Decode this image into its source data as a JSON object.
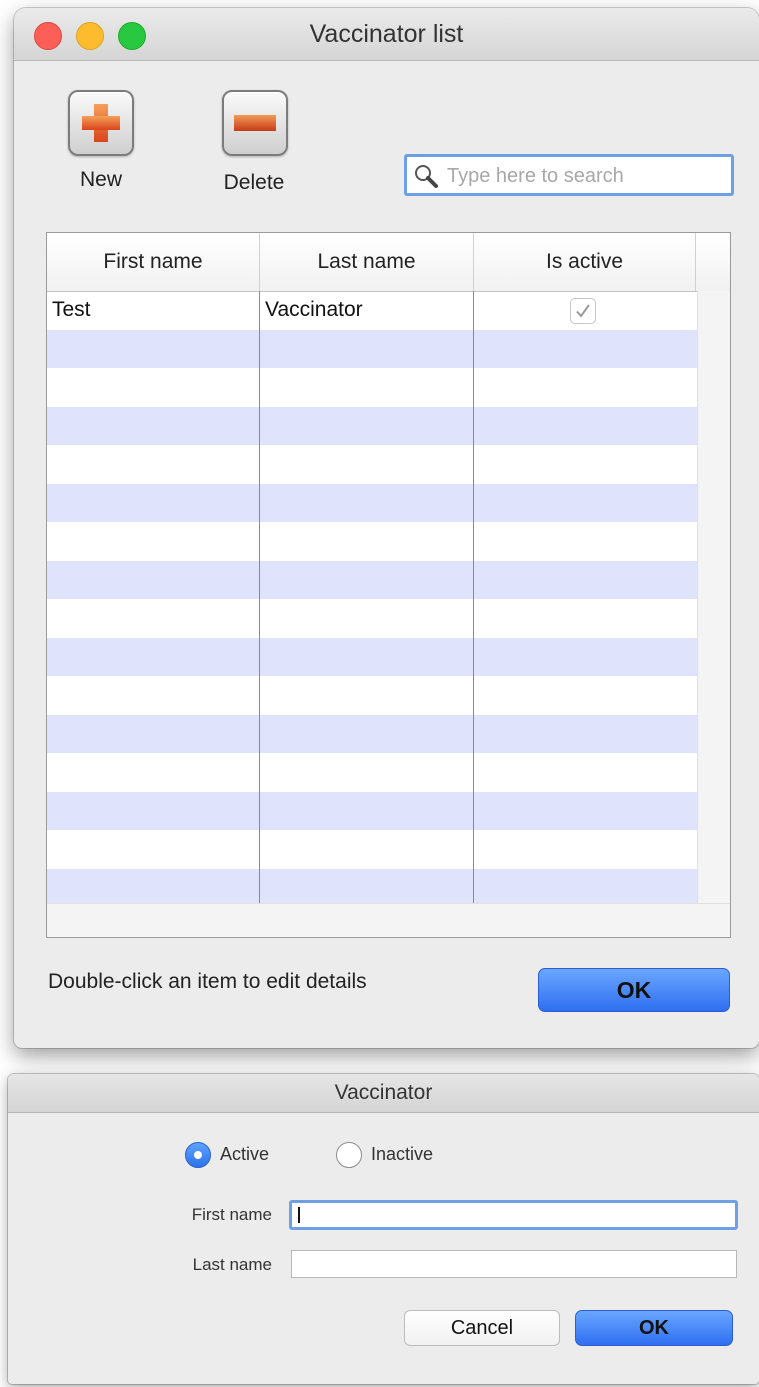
{
  "vaccinator_list_window": {
    "title": "Vaccinator list",
    "toolbar": {
      "new_label": "New",
      "delete_label": "Delete",
      "search_placeholder": "Type here to search"
    },
    "table": {
      "columns": [
        "First name",
        "Last name",
        "Is active"
      ],
      "rows": [
        {
          "first_name": "Test",
          "last_name": "Vaccinator",
          "is_active": true
        }
      ]
    },
    "hint": "Double-click an item to edit details",
    "ok_label": "OK",
    "colors": {
      "row_alt": "#dfe3fb",
      "accent": "#2f6ff0"
    }
  },
  "vaccinator_window": {
    "title": "Vaccinator",
    "status_options": {
      "active_label": "Active",
      "inactive_label": "Inactive",
      "selected": "Active"
    },
    "first_name_label": "First name",
    "last_name_label": "Last name",
    "first_name_value": "",
    "last_name_value": "",
    "cancel_label": "Cancel",
    "ok_label": "OK"
  }
}
